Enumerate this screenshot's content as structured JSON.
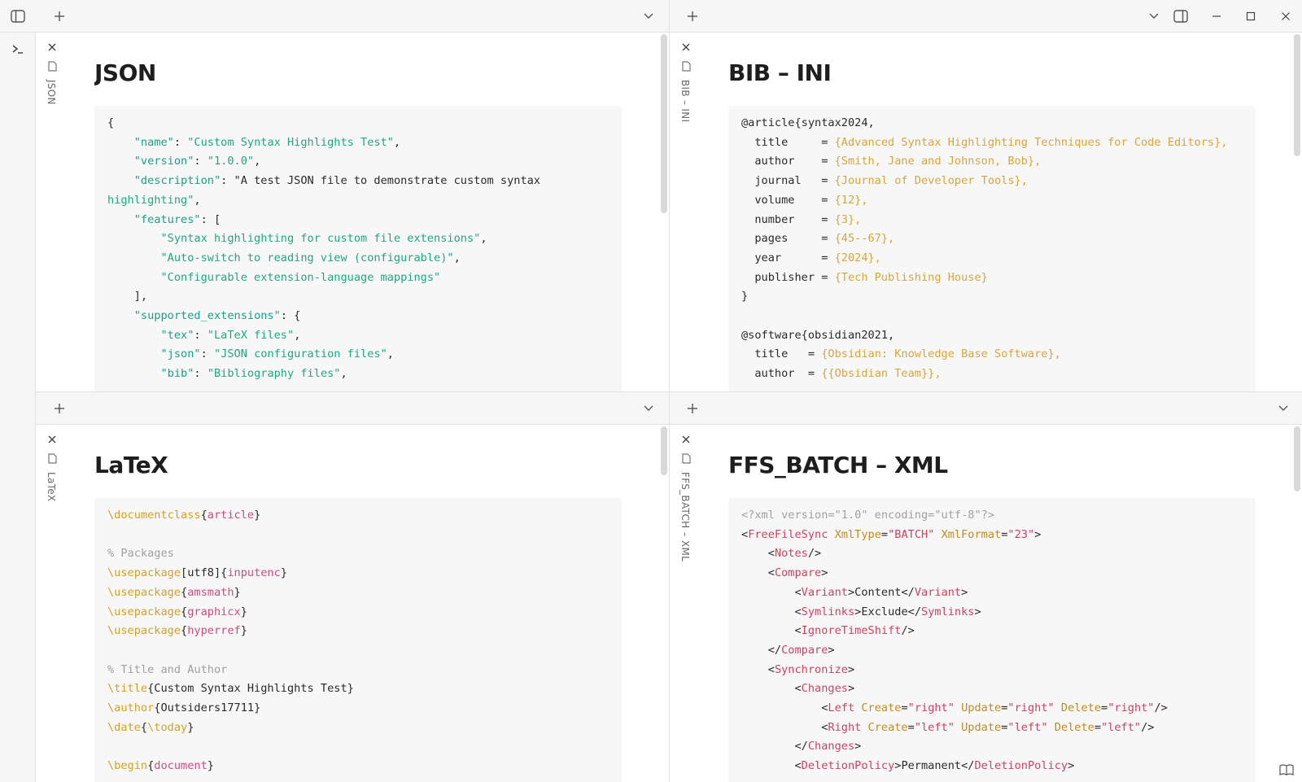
{
  "window": {
    "title": ""
  },
  "ribbon": {
    "items": [
      {
        "icon": "sidebar-toggle-icon"
      },
      {
        "icon": "terminal-icon"
      }
    ]
  },
  "panes": {
    "top_left": {
      "tab_label": "JSON",
      "title": "JSON",
      "code_lines": [
        "{",
        "    \"name\": \"Custom Syntax Highlights Test\",",
        "    \"version\": \"1.0.0\",",
        "    \"description\": \"A test JSON file to demonstrate custom syntax",
        "highlighting\",",
        "    \"features\": [",
        "        \"Syntax highlighting for custom file extensions\",",
        "        \"Auto-switch to reading view (configurable)\",",
        "        \"Configurable extension-language mappings\"",
        "    ],",
        "    \"supported_extensions\": {",
        "        \"tex\": \"LaTeX files\",",
        "        \"json\": \"JSON configuration files\",",
        "        \"bib\": \"Bibliography files\","
      ]
    },
    "top_right": {
      "tab_label": "BIB – INI",
      "title": "BIB – INI",
      "code_lines": [
        "@article{syntax2024,",
        "  title     = {Advanced Syntax Highlighting Techniques for Code Editors},",
        "  author    = {Smith, Jane and Johnson, Bob},",
        "  journal   = {Journal of Developer Tools},",
        "  volume    = {12},",
        "  number    = {3},",
        "  pages     = {45--67},",
        "  year      = {2024},",
        "  publisher = {Tech Publishing House}",
        "}",
        "",
        "@software{obsidian2021,",
        "  title   = {Obsidian: Knowledge Base Software},",
        "  author  = {{Obsidian Team}},"
      ]
    },
    "bottom_left": {
      "tab_label": "LaTeX",
      "title": "LaTeX",
      "code_lines": [
        "\\documentclass{article}",
        "",
        "% Packages",
        "\\usepackage[utf8]{inputenc}",
        "\\usepackage{amsmath}",
        "\\usepackage{graphicx}",
        "\\usepackage{hyperref}",
        "",
        "% Title and Author",
        "\\title{Custom Syntax Highlights Test}",
        "\\author{Outsiders17711}",
        "\\date{\\today}",
        "",
        "\\begin{document}"
      ]
    },
    "bottom_right": {
      "tab_label": "FFS_BATCH – XML",
      "title": "FFS_BATCH – XML",
      "code_lines": [
        "<?xml version=\"1.0\" encoding=\"utf-8\"?>",
        "<FreeFileSync XmlType=\"BATCH\" XmlFormat=\"23\">",
        "    <Notes/>",
        "    <Compare>",
        "        <Variant>Content</Variant>",
        "        <Symlinks>Exclude</Symlinks>",
        "        <IgnoreTimeShift/>",
        "    </Compare>",
        "    <Synchronize>",
        "        <Changes>",
        "            <Left Create=\"right\" Update=\"right\" Delete=\"right\"/>",
        "            <Right Create=\"left\" Update=\"left\" Delete=\"left\"/>",
        "        </Changes>",
        "        <DeletionPolicy>Permanent</DeletionPolicy>"
      ]
    }
  },
  "colors": {
    "json_key": "#18a087",
    "json_string": "#1ea97a",
    "bib_value": "#d9a53a",
    "tex_command": "#d4a024",
    "tex_argument": "#d24a7d",
    "comment": "#a0a0a0",
    "xml_tag": "#d1405f",
    "xml_attr": "#c28a1a"
  }
}
